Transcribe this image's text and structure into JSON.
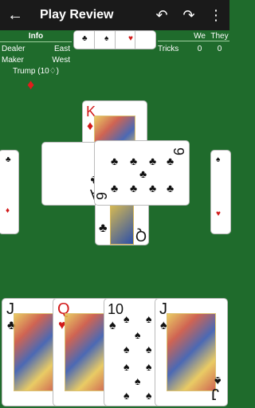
{
  "topbar": {
    "title": "Play Review",
    "back_icon": "←",
    "undo_icon": "↶",
    "redo_icon": "↷",
    "more_icon": "⋮"
  },
  "info": {
    "header": "Info",
    "dealer_label": "Dealer",
    "dealer_value": "East",
    "maker_label": "Maker",
    "maker_value": "West",
    "trump": "Trump (10♢)",
    "trump_icon": "♦"
  },
  "score": {
    "we_label": "We",
    "they_label": "They",
    "tricks_label": "Tricks",
    "tricks_we": "0",
    "tricks_they": "0"
  },
  "table_cards": {
    "king": {
      "rank": "K",
      "suit": "♦"
    },
    "ace": {
      "rank": "A",
      "suit": "♣"
    },
    "nine_clubs": {
      "rank": "9",
      "suit": "♣"
    },
    "queen_clubs": {
      "rank": "Q",
      "suit": "♣"
    }
  },
  "hand": [
    {
      "rank": "J",
      "suit": "♣"
    },
    {
      "rank": "Q",
      "suit": "♥"
    },
    {
      "rank": "10",
      "suit": "♠"
    },
    {
      "rank": "J",
      "suit": "♠"
    }
  ],
  "colors": {
    "felt": "#1f6b2c",
    "topbar": "#1a1a1a",
    "red_suit": "#d21a1a"
  }
}
